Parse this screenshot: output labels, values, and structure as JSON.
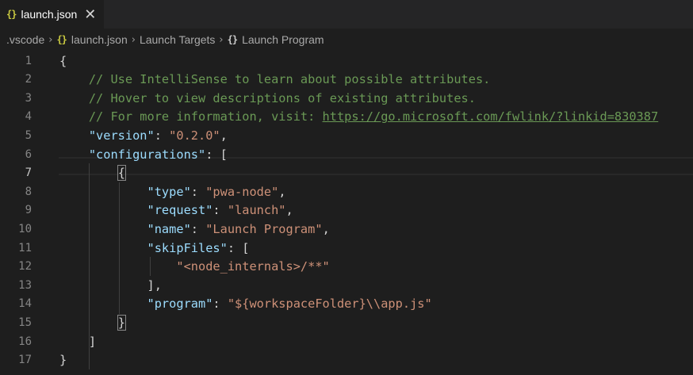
{
  "tab": {
    "icon": "{}",
    "label": "launch.json",
    "close": "✕"
  },
  "breadcrumb": {
    "folder": ".vscode",
    "file_icon": "{}",
    "file": "launch.json",
    "section": "Launch Targets",
    "item_icon": "{}",
    "item": "Launch Program"
  },
  "lines": [
    {
      "num": "1",
      "segs": [
        {
          "c": "p",
          "t": "{"
        }
      ]
    },
    {
      "num": "2",
      "segs": [
        {
          "c": "c",
          "t": "    // Use IntelliSense to learn about possible attributes."
        }
      ]
    },
    {
      "num": "3",
      "segs": [
        {
          "c": "c",
          "t": "    // Hover to view descriptions of existing attributes."
        }
      ]
    },
    {
      "num": "4",
      "segs": [
        {
          "c": "c",
          "t": "    // For more information, visit: "
        },
        {
          "c": "c u",
          "t": "https://go.microsoft.com/fwlink/?linkid=830387"
        }
      ]
    },
    {
      "num": "5",
      "segs": [
        {
          "c": "p",
          "t": "    "
        },
        {
          "c": "k",
          "t": "\"version\""
        },
        {
          "c": "p",
          "t": ": "
        },
        {
          "c": "s",
          "t": "\"0.2.0\""
        },
        {
          "c": "p",
          "t": ","
        }
      ]
    },
    {
      "num": "6",
      "segs": [
        {
          "c": "p",
          "t": "    "
        },
        {
          "c": "k",
          "t": "\"configurations\""
        },
        {
          "c": "p",
          "t": ": ["
        }
      ]
    },
    {
      "num": "7",
      "segs": [
        {
          "c": "p",
          "t": "        "
        },
        {
          "c": "p br",
          "t": "{"
        }
      ]
    },
    {
      "num": "8",
      "segs": [
        {
          "c": "p",
          "t": "            "
        },
        {
          "c": "k",
          "t": "\"type\""
        },
        {
          "c": "p",
          "t": ": "
        },
        {
          "c": "s",
          "t": "\"pwa-node\""
        },
        {
          "c": "p",
          "t": ","
        }
      ]
    },
    {
      "num": "9",
      "segs": [
        {
          "c": "p",
          "t": "            "
        },
        {
          "c": "k",
          "t": "\"request\""
        },
        {
          "c": "p",
          "t": ": "
        },
        {
          "c": "s",
          "t": "\"launch\""
        },
        {
          "c": "p",
          "t": ","
        }
      ]
    },
    {
      "num": "10",
      "segs": [
        {
          "c": "p",
          "t": "            "
        },
        {
          "c": "k",
          "t": "\"name\""
        },
        {
          "c": "p",
          "t": ": "
        },
        {
          "c": "s",
          "t": "\"Launch Program\""
        },
        {
          "c": "p",
          "t": ","
        }
      ]
    },
    {
      "num": "11",
      "segs": [
        {
          "c": "p",
          "t": "            "
        },
        {
          "c": "k",
          "t": "\"skipFiles\""
        },
        {
          "c": "p",
          "t": ": ["
        }
      ]
    },
    {
      "num": "12",
      "segs": [
        {
          "c": "p",
          "t": "                "
        },
        {
          "c": "s",
          "t": "\"<node_internals>/**\""
        }
      ]
    },
    {
      "num": "13",
      "segs": [
        {
          "c": "p",
          "t": "            ],"
        }
      ]
    },
    {
      "num": "14",
      "segs": [
        {
          "c": "p",
          "t": "            "
        },
        {
          "c": "k",
          "t": "\"program\""
        },
        {
          "c": "p",
          "t": ": "
        },
        {
          "c": "s",
          "t": "\"${workspaceFolder}\\\\app.js\""
        }
      ]
    },
    {
      "num": "15",
      "segs": [
        {
          "c": "p",
          "t": "        "
        },
        {
          "c": "p br",
          "t": "}"
        }
      ]
    },
    {
      "num": "16",
      "segs": [
        {
          "c": "p",
          "t": "    ]"
        }
      ]
    },
    {
      "num": "17",
      "segs": [
        {
          "c": "p",
          "t": "}"
        }
      ]
    }
  ]
}
